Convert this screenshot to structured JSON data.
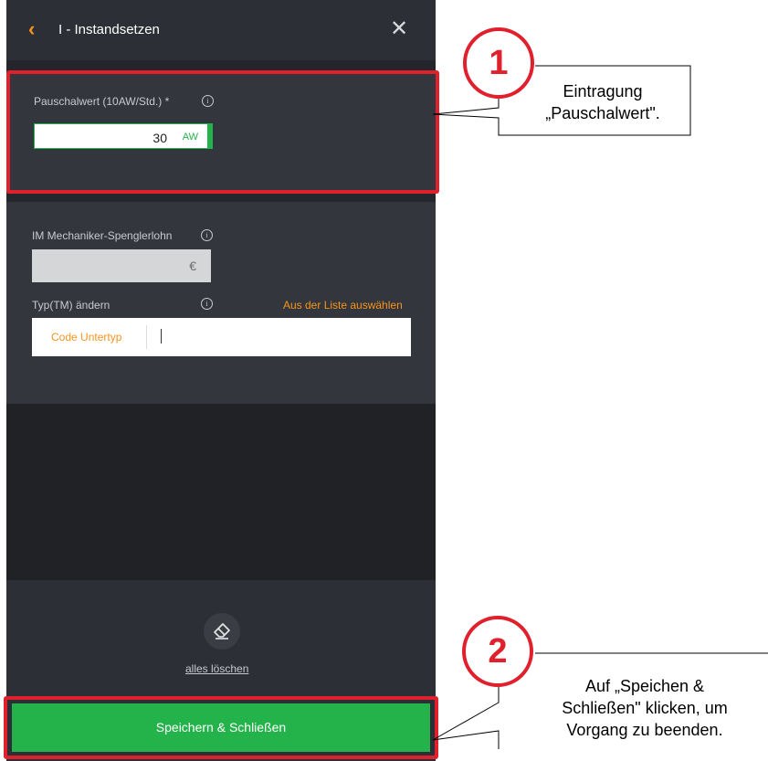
{
  "header": {
    "title": "I - Instandsetzen",
    "back_icon": "‹",
    "close_icon": "✕"
  },
  "section1": {
    "label": "Pauschalwert (10AW/Std.) *",
    "value": "30",
    "unit": "AW"
  },
  "section2": {
    "wage_label": "IM Mechaniker-Spenglerlohn",
    "wage_value": "",
    "wage_unit": "€",
    "type_label": "Typ(TM) ändern",
    "select_link": "Aus der Liste auswählen",
    "code_label": "Code Untertyp"
  },
  "footer": {
    "clear_label": "alles löschen",
    "save_label": "Speichern & Schließen"
  },
  "annotations": {
    "callout1": {
      "number": "1",
      "text_line1": "Eintragung",
      "text_line2": "„Pauschalwert\"."
    },
    "callout2": {
      "number": "2",
      "text_line1": "Auf „Speichen &",
      "text_line2": "Schließen\" klicken, um",
      "text_line3": "Vorgang zu beenden."
    }
  },
  "colors": {
    "accent_orange": "#f7941d",
    "accent_green": "#24b34b",
    "annotation_red": "#e0202c",
    "panel_dark": "#2c2f35"
  }
}
